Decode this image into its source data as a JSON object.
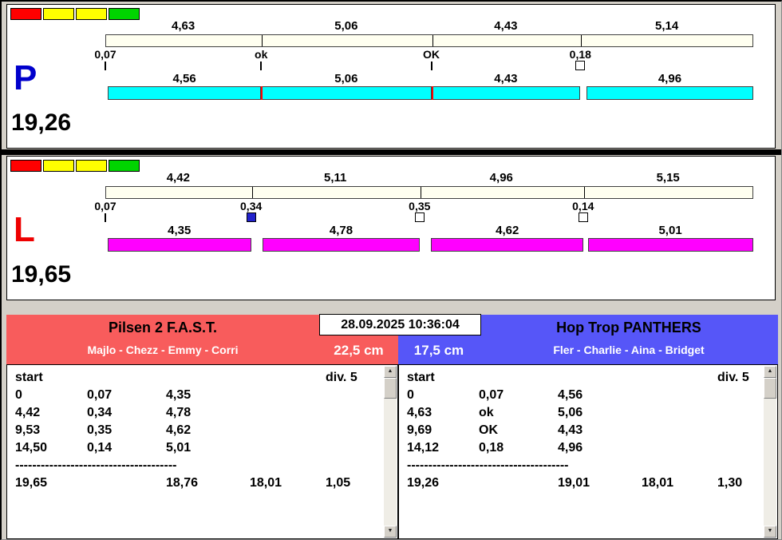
{
  "lanes": [
    {
      "id": "P",
      "letter": "P",
      "letter_color": "#0000cc",
      "bar_color": "#00ffff",
      "total_label": "19,26",
      "total_value": 19.26,
      "status_colors": [
        "#ff0000",
        "#ffff00",
        "#ffff00",
        "#00d400"
      ],
      "legs": [
        {
          "leg_label": "4,63",
          "leg_value": 4.63,
          "change_label": "0,07",
          "change_value": 0.07,
          "marker": "tick",
          "marker_fill": "",
          "dog_label": "4,56",
          "dog_value": 4.56
        },
        {
          "leg_label": "5,06",
          "leg_value": 5.06,
          "change_label": "ok",
          "change_value": 0,
          "marker": "tick",
          "marker_fill": "",
          "dog_label": "5,06",
          "dog_value": 5.06
        },
        {
          "leg_label": "4,43",
          "leg_value": 4.43,
          "change_label": "OK",
          "change_value": 0,
          "marker": "tick",
          "marker_fill": "",
          "dog_label": "4,43",
          "dog_value": 4.43
        },
        {
          "leg_label": "5,14",
          "leg_value": 5.14,
          "change_label": "0,18",
          "change_value": 0.18,
          "marker": "square",
          "marker_fill": "#ffffff",
          "dog_label": "4,96",
          "dog_value": 4.96
        }
      ]
    },
    {
      "id": "L",
      "letter": "L",
      "letter_color": "#ee0000",
      "bar_color": "#ff00ff",
      "total_label": "19,65",
      "total_value": 19.65,
      "status_colors": [
        "#ff0000",
        "#ffff00",
        "#ffff00",
        "#00d400"
      ],
      "legs": [
        {
          "leg_label": "4,42",
          "leg_value": 4.42,
          "change_label": "0,07",
          "change_value": 0.07,
          "marker": "tick",
          "marker_fill": "",
          "dog_label": "4,35",
          "dog_value": 4.35
        },
        {
          "leg_label": "5,11",
          "leg_value": 5.11,
          "change_label": "0,34",
          "change_value": 0.34,
          "marker": "square",
          "marker_fill": "#2222cc",
          "dog_label": "4,78",
          "dog_value": 4.78
        },
        {
          "leg_label": "4,96",
          "leg_value": 4.96,
          "change_label": "0,35",
          "change_value": 0.35,
          "marker": "square",
          "marker_fill": "#ffffff",
          "dog_label": "4,62",
          "dog_value": 4.62
        },
        {
          "leg_label": "5,15",
          "leg_value": 5.15,
          "change_label": "0,14",
          "change_value": 0.14,
          "marker": "square",
          "marker_fill": "#ffffff",
          "dog_label": "5,01",
          "dog_value": 5.01
        }
      ]
    }
  ],
  "footer": {
    "timestamp": "28.09.2025 10:36:04",
    "left": {
      "team_name": "Pilsen 2 F.A.S.T.",
      "members": "Majlo - Chezz - Emmy - Corri",
      "distance": "22,5 cm",
      "header_color": "#f85c5c",
      "table": {
        "start_label": "start",
        "div_label": "div. 5",
        "rows": [
          [
            "0",
            "0,07",
            "4,35"
          ],
          [
            "4,42",
            "0,34",
            "4,78"
          ],
          [
            "9,53",
            "0,35",
            "4,62"
          ],
          [
            "14,50",
            "0,14",
            "5,01"
          ]
        ],
        "separator": "--------------------------------------",
        "summary": [
          "19,65",
          "18,76",
          "18,01",
          "1,05"
        ]
      }
    },
    "right": {
      "team_name": "Hop Trop PANTHERS",
      "members": "Fler - Charlie - Aina - Bridget",
      "distance": "17,5 cm",
      "header_color": "#5656f8",
      "table": {
        "start_label": "start",
        "div_label": "div. 5",
        "rows": [
          [
            "0",
            "0,07",
            "4,56"
          ],
          [
            "4,63",
            "ok",
            "5,06"
          ],
          [
            "9,69",
            "OK",
            "4,43"
          ],
          [
            "14,12",
            "0,18",
            "4,96"
          ]
        ],
        "separator": "--------------------------------------",
        "summary": [
          "19,26",
          "19,01",
          "18,01",
          "1,30"
        ]
      }
    }
  }
}
